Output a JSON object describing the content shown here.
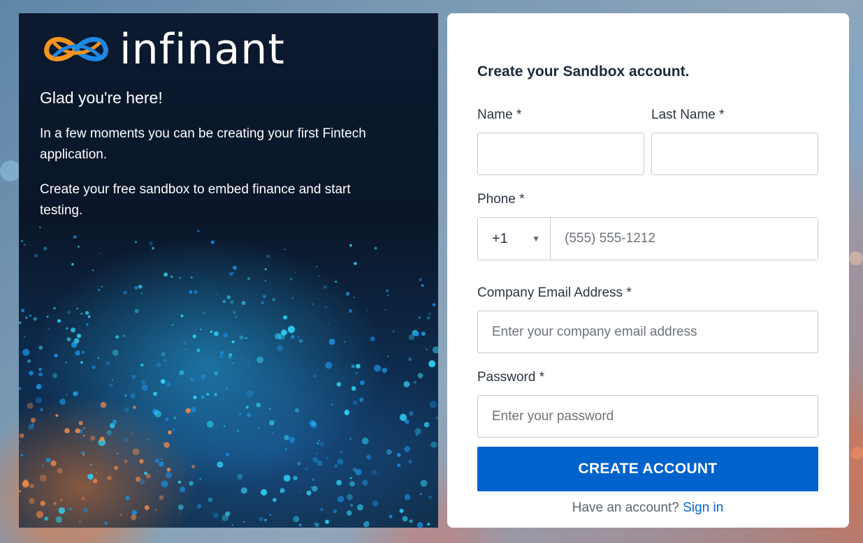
{
  "brand": {
    "logo_text": "infinant",
    "logo_icon": "infinity-knot-icon",
    "colors": {
      "orange": "#f7941d",
      "blue": "#1e88e5",
      "primary_button": "#0063cc",
      "link": "#0063cc"
    }
  },
  "hero": {
    "heading": "Glad you're here!",
    "paragraph_1": "In a few moments you can be creating your first Fintech application.",
    "paragraph_2": "Create your free sandbox to embed finance and start testing."
  },
  "form": {
    "title": "Create your Sandbox account.",
    "first_name": {
      "label": "Name *",
      "value": "",
      "placeholder": ""
    },
    "last_name": {
      "label": "Last Name *",
      "value": "",
      "placeholder": ""
    },
    "phone": {
      "label": "Phone *",
      "country_code": "+1",
      "placeholder": "(555) 555-1212",
      "value": ""
    },
    "email": {
      "label": "Company Email Address *",
      "placeholder": "Enter your company email address",
      "value": ""
    },
    "password": {
      "label": "Password *",
      "placeholder": "Enter your password",
      "value": ""
    },
    "submit_label": "CREATE ACCOUNT",
    "signin_prompt": "Have an account?",
    "signin_link": "Sign in"
  }
}
